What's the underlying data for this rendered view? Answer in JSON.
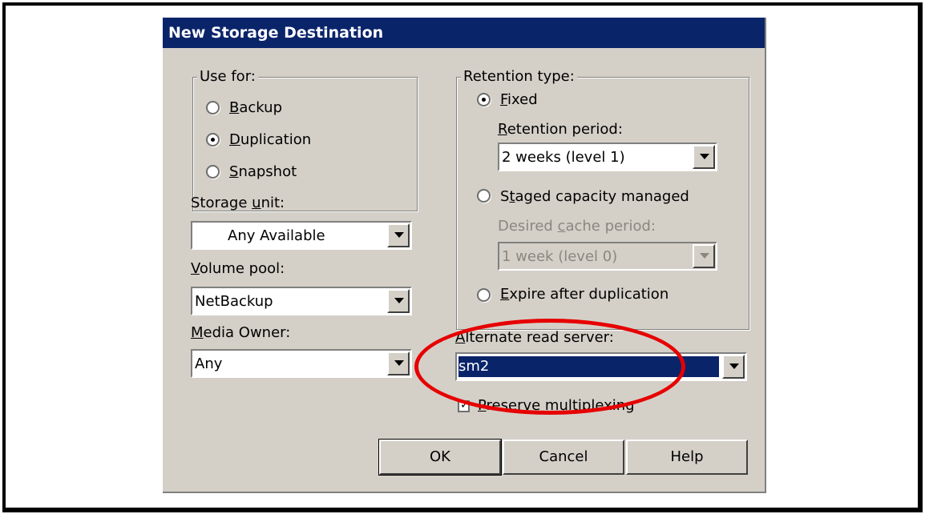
{
  "dialog": {
    "title": "New Storage Destination"
  },
  "use_for": {
    "legend": "Use for:",
    "options": [
      {
        "mnemonic": "B",
        "rest": "ackup",
        "selected": false
      },
      {
        "mnemonic": "D",
        "rest": "uplication",
        "selected": true
      },
      {
        "mnemonic": "S",
        "rest": "napshot",
        "selected": false
      }
    ]
  },
  "storage_unit": {
    "label_pre": "Storage ",
    "label_mn": "u",
    "label_post": "nit:",
    "value": "Any Available"
  },
  "volume_pool": {
    "label_mn": "V",
    "label_post": "olume pool:",
    "value": "NetBackup"
  },
  "media_owner": {
    "label_mn": "M",
    "label_post": "edia Owner:",
    "value": "Any"
  },
  "retention": {
    "legend": "Retention type:",
    "fixed": {
      "mnemonic": "F",
      "rest": "ixed",
      "selected": true
    },
    "period_label": {
      "mnemonic": "R",
      "rest": "etention period:"
    },
    "period_value": "2 weeks (level 1)",
    "staged": {
      "pre": "S",
      "mnemonic": "t",
      "rest": "aged capacity managed",
      "selected": false
    },
    "cache_label": {
      "pre": "Desired ",
      "mnemonic": "c",
      "rest": "ache period:"
    },
    "cache_value": "1 week (level 0)",
    "expire": {
      "mnemonic": "E",
      "rest": "xpire after duplication",
      "selected": false
    }
  },
  "alternate_read": {
    "label_mn": "A",
    "label_post": "lternate read server:",
    "value": "sm2"
  },
  "preserve": {
    "mnemonic": "P",
    "rest": "reserve multiplexing",
    "checked": true
  },
  "buttons": {
    "ok": "OK",
    "cancel": "Cancel",
    "help": "Help"
  },
  "colors": {
    "titlebar": "#0a246a",
    "dialog": "#d4d0c8",
    "highlight_ellipse": "#e60000"
  }
}
